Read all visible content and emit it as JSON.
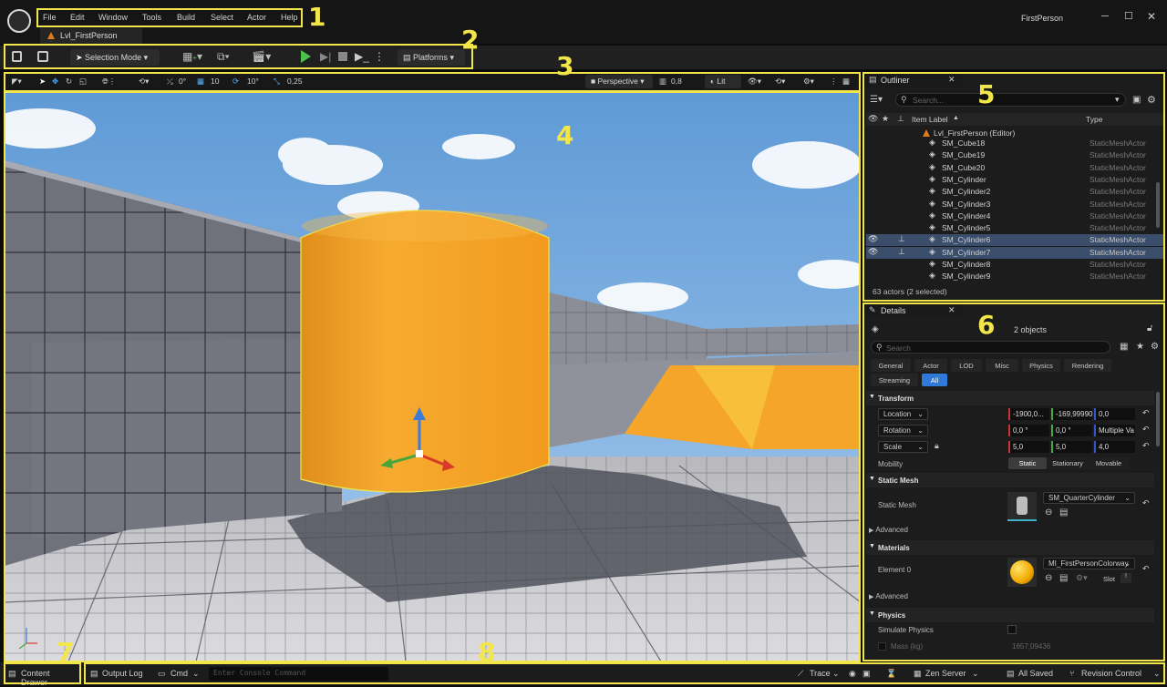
{
  "app": {
    "window_title": "FirstPerson",
    "level_tab": "Lvl_FirstPerson"
  },
  "menu": [
    "File",
    "Edit",
    "Window",
    "Tools",
    "Build",
    "Select",
    "Actor",
    "Help"
  ],
  "toolbar": {
    "selection_mode": "Selection Mode",
    "platforms": "Platforms"
  },
  "viewport_toolbar": {
    "angle_snap": "0°",
    "grid_snap": "10",
    "rotation_snap": "10°",
    "scale_snap": "0,25",
    "view": "Perspective",
    "camera_speed": "0,8",
    "view_mode": "Lit"
  },
  "outliner": {
    "tab": "Outliner",
    "search_placeholder": "Search...",
    "col_label": "Item Label",
    "col_type": "Type",
    "root": "Lvl_FirstPerson (Editor)",
    "rows": [
      {
        "label": "SM_Cube18",
        "type": "StaticMeshActor",
        "selected": false
      },
      {
        "label": "SM_Cube19",
        "type": "StaticMeshActor",
        "selected": false
      },
      {
        "label": "SM_Cube20",
        "type": "StaticMeshActor",
        "selected": false
      },
      {
        "label": "SM_Cylinder",
        "type": "StaticMeshActor",
        "selected": false
      },
      {
        "label": "SM_Cylinder2",
        "type": "StaticMeshActor",
        "selected": false
      },
      {
        "label": "SM_Cylinder3",
        "type": "StaticMeshActor",
        "selected": false
      },
      {
        "label": "SM_Cylinder4",
        "type": "StaticMeshActor",
        "selected": false
      },
      {
        "label": "SM_Cylinder5",
        "type": "StaticMeshActor",
        "selected": false
      },
      {
        "label": "SM_Cylinder6",
        "type": "StaticMeshActor",
        "selected": true
      },
      {
        "label": "SM_Cylinder7",
        "type": "StaticMeshActor",
        "selected": true
      },
      {
        "label": "SM_Cylinder8",
        "type": "StaticMeshActor",
        "selected": false
      },
      {
        "label": "SM_Cylinder9",
        "type": "StaticMeshActor",
        "selected": false
      }
    ],
    "footer": "63 actors (2 selected)"
  },
  "details": {
    "tab": "Details",
    "objects": "2 objects",
    "search_placeholder": "Search",
    "categories": [
      "General",
      "Actor",
      "LOD",
      "Misc",
      "Physics",
      "Rendering",
      "Streaming",
      "All"
    ],
    "transform": {
      "title": "Transform",
      "location_label": "Location",
      "location": [
        "-1900,0...",
        "-169,99990",
        "0,0"
      ],
      "rotation_label": "Rotation",
      "rotation": [
        "0,0 °",
        "0,0 °",
        "Multiple Va"
      ],
      "scale_label": "Scale",
      "scale": [
        "5,0",
        "5,0",
        "4,0"
      ],
      "mobility_label": "Mobility",
      "mobility_options": [
        "Static",
        "Stationary",
        "Movable"
      ]
    },
    "static_mesh": {
      "title": "Static Mesh",
      "label": "Static Mesh",
      "value": "SM_QuarterCylinder",
      "advanced": "Advanced"
    },
    "materials": {
      "title": "Materials",
      "element_label": "Element 0",
      "value": "MI_FirstPersonColorway",
      "slot": "Slot",
      "advanced": "Advanced"
    },
    "physics": {
      "title": "Physics",
      "simulate": "Simulate Physics",
      "mass_label": "Mass (kg)",
      "mass": "1657,09436"
    }
  },
  "statusbar": {
    "content_drawer": "Content Drawer",
    "output_log": "Output Log",
    "cmd": "Cmd",
    "console_placeholder": "Enter Console Command",
    "trace": "Trace",
    "zen_server": "Zen Server",
    "all_saved": "All Saved",
    "revision_control": "Revision Control"
  },
  "annotations": [
    "1",
    "2",
    "3",
    "4",
    "5",
    "6",
    "7",
    "8"
  ],
  "colors": {
    "highlight": "#f2e64a",
    "selection_row": "#3a4d6a",
    "active_tab": "#2f7ad9",
    "mesh_orange": "#f4a52a",
    "play_green": "#4cc24c"
  }
}
